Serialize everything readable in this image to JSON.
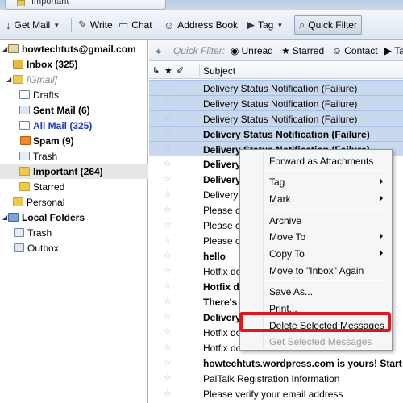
{
  "tab": {
    "label": "Important"
  },
  "toolbar": {
    "get_mail": "Get Mail",
    "write": "Write",
    "chat": "Chat",
    "address_book": "Address Book",
    "tag": "Tag",
    "quick_filter": "Quick Filter"
  },
  "folders": {
    "account": "howtechtuts@gmail.com",
    "inbox": "Inbox (325)",
    "gmail": "[Gmail]",
    "drafts": "Drafts",
    "sent": "Sent Mail (6)",
    "all": "All Mail (325)",
    "spam": "Spam (9)",
    "trash": "Trash",
    "important": "Important (264)",
    "starred": "Starred",
    "personal": "Personal",
    "local_folders": "Local Folders",
    "local_trash": "Trash",
    "outbox": "Outbox"
  },
  "quickfilter_bar": {
    "label": "Quick Filter:",
    "unread": "Unread",
    "starred": "Starred",
    "contact": "Contact",
    "tags": "Ta"
  },
  "columns": {
    "subject": "Subject"
  },
  "messages": [
    {
      "subject": "Delivery Status Notification (Failure)",
      "selected": true,
      "unread": false
    },
    {
      "subject": "Delivery Status Notification (Failure)",
      "selected": true,
      "unread": false
    },
    {
      "subject": "Delivery Status Notification (Failure)",
      "selected": true,
      "unread": false
    },
    {
      "subject": "Delivery Status Notification (Failure)",
      "selected": true,
      "unread": true
    },
    {
      "subject": "Delivery Status Notification (Failure)",
      "selected": true,
      "unread": true
    },
    {
      "subject": "Delivery S",
      "selected": false,
      "unread": true
    },
    {
      "subject": "Delivery S",
      "selected": false,
      "unread": true
    },
    {
      "subject": "Delivery S",
      "selected": false,
      "unread": false
    },
    {
      "subject": "Please cor",
      "selected": false,
      "unread": false
    },
    {
      "subject": "Please cor",
      "selected": false,
      "unread": false
    },
    {
      "subject": "Please cor",
      "selected": false,
      "unread": false
    },
    {
      "subject": "hello",
      "selected": false,
      "unread": true
    },
    {
      "subject": "Hotfix dov",
      "selected": false,
      "unread": false
    },
    {
      "subject": "Hotfix do",
      "selected": false,
      "unread": true
    },
    {
      "subject": "There's b                                          pul",
      "selected": false,
      "unread": true
    },
    {
      "subject": "Delivery",
      "selected": false,
      "unread": true
    },
    {
      "subject": "Hotfix dov",
      "selected": false,
      "unread": false
    },
    {
      "subject": "Hotfix dov",
      "selected": false,
      "unread": false
    },
    {
      "subject": "howtechtuts.wordpress.com is yours! Start cust",
      "selected": false,
      "unread": true
    },
    {
      "subject": "PalTalk Registration Information",
      "selected": false,
      "unread": false
    },
    {
      "subject": "Please verify your email address",
      "selected": false,
      "unread": false
    }
  ],
  "context_menu": {
    "forward_attachments": "Forward as Attachments",
    "tag": "Tag",
    "mark": "Mark",
    "archive": "Archive",
    "move_to": "Move To",
    "copy_to": "Copy To",
    "move_again": "Move to \"Inbox\" Again",
    "save_as": "Save As...",
    "print": "Print...",
    "delete_selected": "Delete Selected Messages",
    "get_selected": "Get Selected Messages"
  },
  "colors": {
    "highlight": "#e3151a",
    "selection": "#c8d9ef"
  }
}
